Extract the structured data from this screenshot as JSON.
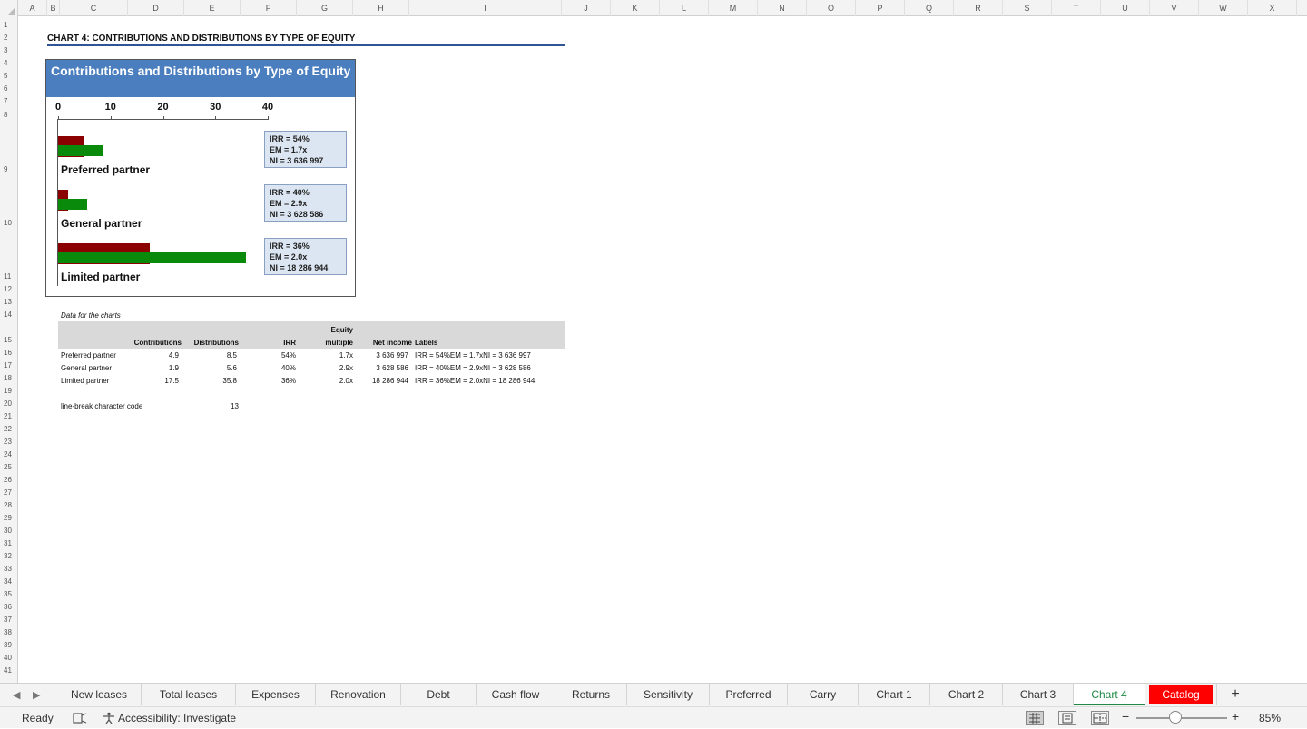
{
  "columns": [
    "A",
    "B",
    "C",
    "D",
    "E",
    "F",
    "G",
    "H",
    "I",
    "J",
    "K",
    "L",
    "M",
    "N",
    "O",
    "P",
    "Q",
    "R",
    "S",
    "T",
    "U",
    "V",
    "W",
    "X"
  ],
  "rows": [
    "1",
    "2",
    "3",
    "4",
    "5",
    "6",
    "7",
    "8",
    "9",
    "10",
    "11",
    "12",
    "13",
    "14",
    "15",
    "16",
    "17",
    "18",
    "19",
    "20",
    "21",
    "22",
    "23",
    "24",
    "25",
    "26",
    "27",
    "28",
    "29",
    "30",
    "31",
    "32",
    "33",
    "34",
    "35",
    "36",
    "37",
    "38",
    "39",
    "40",
    "41"
  ],
  "sheet_title": "CHART 4: CONTRIBUTIONS AND DISTRIBUTIONS BY TYPE OF EQUITY",
  "chart_data": {
    "type": "bar",
    "orientation": "horizontal",
    "title": "Contributions and Distributions by Type of Equity",
    "categories": [
      "Preferred partner",
      "General partner",
      "Limited partner"
    ],
    "series": [
      {
        "values": [
          4.9,
          1.9,
          17.5
        ],
        "color": "#8b0000"
      },
      {
        "values": [
          8.5,
          5.6,
          35.8
        ],
        "color": "#0a8a0a"
      }
    ],
    "x_ticks": [
      "0",
      "10",
      "20",
      "30",
      "40"
    ],
    "xlim": [
      0,
      40
    ],
    "annotations": [
      [
        "IRR = 54%",
        "EM = 1.7x",
        "NI = 3 636 997"
      ],
      [
        "IRR = 40%",
        "EM = 2.9x",
        "NI = 3 628 586"
      ],
      [
        "IRR = 36%",
        "EM = 2.0x",
        "NI = 18 286 944"
      ]
    ]
  },
  "table": {
    "caption": "Data for the charts",
    "headers": {
      "contributions": "Contributions",
      "distributions": "Distributions",
      "irr": "IRR",
      "equity_multiple_1": "Equity",
      "equity_multiple_2": "multiple",
      "net_income": "Net income",
      "labels": "Labels"
    },
    "rows": [
      {
        "name": "Preferred partner",
        "contributions": "4.9",
        "distributions": "8.5",
        "irr": "54%",
        "em": "1.7x",
        "ni": "3 636 997",
        "label": "IRR = 54%EM = 1.7xNI = 3 636 997"
      },
      {
        "name": "General partner",
        "contributions": "1.9",
        "distributions": "5.6",
        "irr": "40%",
        "em": "2.9x",
        "ni": "3 628 586",
        "label": "IRR = 40%EM = 2.9xNI = 3 628 586"
      },
      {
        "name": "Limited partner",
        "contributions": "17.5",
        "distributions": "35.8",
        "irr": "36%",
        "em": "2.0x",
        "ni": "18 286 944",
        "label": "IRR = 36%EM = 2.0xNI = 18 286 944"
      }
    ],
    "linebreak_label": "line-break character code",
    "linebreak_value": "13"
  },
  "tabs": [
    "New leases",
    "Total leases",
    "Expenses",
    "Renovation",
    "Debt",
    "Cash flow",
    "Returns",
    "Sensitivity",
    "Preferred",
    "Carry",
    "Chart 1",
    "Chart 2",
    "Chart 3",
    "Chart 4",
    "Catalog"
  ],
  "active_tab": "Chart 4",
  "add_sheet": "+",
  "status": {
    "ready": "Ready",
    "accessibility": "Accessibility: Investigate",
    "zoom": "85%",
    "zoom_minus": "−",
    "zoom_plus": "+",
    "zoom_level": 0.85
  },
  "icons": {
    "nav_prev": "chevron-left-icon",
    "nav_next": "chevron-right-icon",
    "macro": "macro-record-icon",
    "accessibility": "accessibility-icon"
  },
  "colors": {
    "accent_green": "#1e8a45",
    "catalog_tab": "#ff0000",
    "chart_header": "#4a7ebf"
  }
}
